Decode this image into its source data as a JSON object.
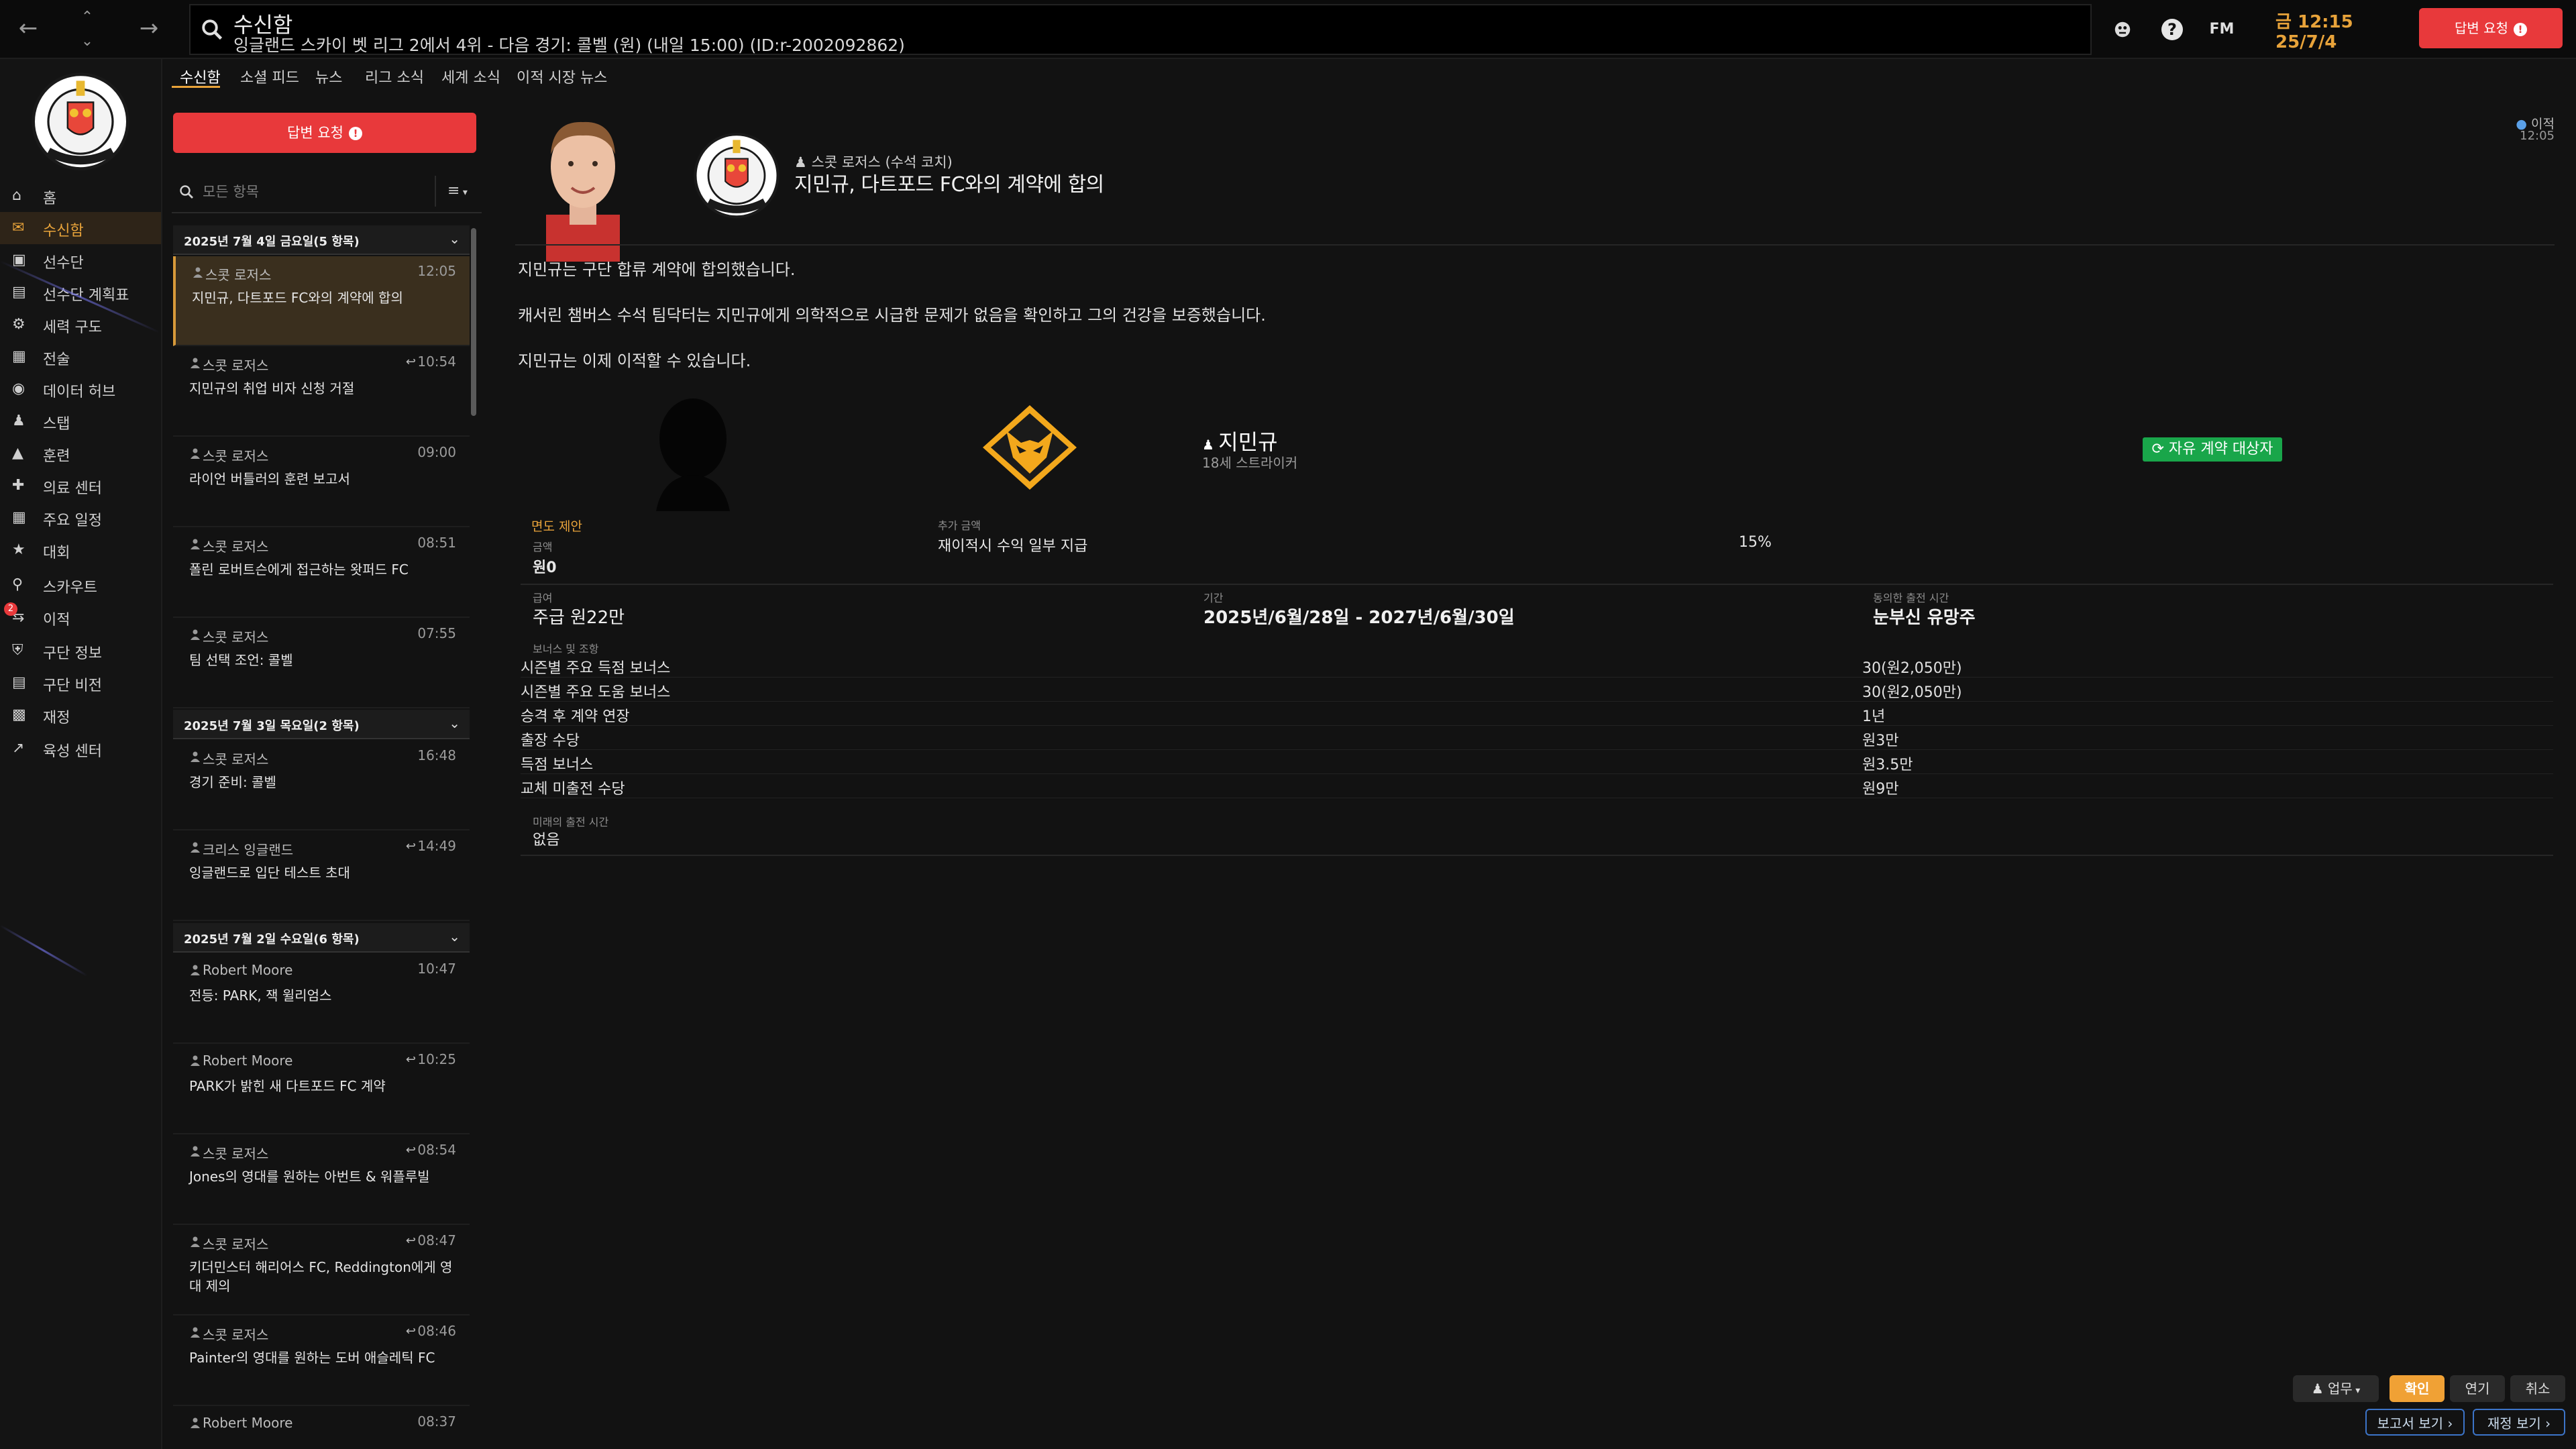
{
  "app": {
    "title": "수신함",
    "subtitle": "잉글랜드 스카이 벳 리그 2에서 4위 - 다음 경기: 콜벨 (원) (내일 15:00) (ID:r-2002092862)",
    "clock_time": "금 12:15",
    "clock_date": "25/7/4",
    "reply_label": "답변 요청",
    "top_icons": [
      "bug-icon",
      "help-icon",
      "fm-icon"
    ],
    "fm_label": "FM",
    "help_label": "?"
  },
  "colors": {
    "accent": "#e8a33a",
    "danger": "#e8393b",
    "success": "#19a64a",
    "link": "#3c74c8"
  },
  "sidebar": {
    "items": [
      {
        "label": "홈",
        "icon": "home-icon"
      },
      {
        "label": "수신함",
        "icon": "inbox-icon",
        "active": true
      },
      {
        "label": "선수단",
        "icon": "shirt-icon"
      },
      {
        "label": "선수단 계획표",
        "icon": "clipboard-icon"
      },
      {
        "label": "세력 구도",
        "icon": "hierarchy-icon"
      },
      {
        "label": "전술",
        "icon": "tactics-icon"
      },
      {
        "label": "데이터 허브",
        "icon": "data-hub-icon"
      },
      {
        "label": "스탭",
        "icon": "staff-icon"
      },
      {
        "label": "훈련",
        "icon": "training-icon"
      },
      {
        "label": "의료 센터",
        "icon": "medical-icon"
      },
      {
        "label": "주요 일정",
        "icon": "calendar-icon"
      },
      {
        "label": "대회",
        "icon": "trophy-icon"
      },
      {
        "label": "스카우트",
        "icon": "scout-icon"
      },
      {
        "label": "이적",
        "icon": "transfer-icon",
        "badge": "2"
      },
      {
        "label": "구단 정보",
        "icon": "club-info-icon"
      },
      {
        "label": "구단 비전",
        "icon": "club-vision-icon"
      },
      {
        "label": "재정",
        "icon": "finance-icon"
      },
      {
        "label": "육성 센터",
        "icon": "development-icon"
      }
    ]
  },
  "tabs": [
    "수신함",
    "소셜 피드",
    "뉴스",
    "리그 소식",
    "세계 소식",
    "이적 시장 뉴스"
  ],
  "list": {
    "search_placeholder": "모든 항목",
    "filter_label": "≡",
    "groups": [
      {
        "title": "2025년 7월 4일 금요일(5 항목)",
        "messages": [
          {
            "sender": "스콧 로저스",
            "time": "12:05",
            "subject": "지민규, 다트포드 FC와의 계약에 합의",
            "selected": true
          },
          {
            "sender": "스콧 로저스",
            "time": "10:54",
            "subject": "지민규의 취업 비자 신청 거절",
            "reply": true
          },
          {
            "sender": "스콧 로저스",
            "time": "09:00",
            "subject": "라이언 버틀러의 훈련 보고서"
          },
          {
            "sender": "스콧 로저스",
            "time": "08:51",
            "subject": "폴린 로버트슨에게 접근하는 왓퍼드 FC"
          },
          {
            "sender": "스콧 로저스",
            "time": "07:55",
            "subject": "팀 선택 조언: 콜벨"
          }
        ]
      },
      {
        "title": "2025년 7월 3일 목요일(2 항목)",
        "messages": [
          {
            "sender": "스콧 로저스",
            "time": "16:48",
            "subject": "경기 준비: 콜벨"
          },
          {
            "sender": "크리스 잉글랜드",
            "time": "14:49",
            "subject": "잉글랜드로 입단 테스트 초대",
            "reply": true
          }
        ]
      },
      {
        "title": "2025년 7월 2일 수요일(6 항목)",
        "messages": [
          {
            "sender": "Robert Moore",
            "time": "10:47",
            "subject": "전등: PARK, 잭 윌리엄스"
          },
          {
            "sender": "Robert Moore",
            "time": "10:25",
            "subject": "PARK가 밝힌 새 다트포드 FC 계약",
            "reply": true
          },
          {
            "sender": "스콧 로저스",
            "time": "08:54",
            "subject": "Jones의 영대를 원하는 아번트 & 워플루빌",
            "reply": true
          },
          {
            "sender": "스콧 로저스",
            "time": "08:47",
            "subject": "키더민스터 해리어스 FC, Reddington에게 영대 제의",
            "reply": true
          },
          {
            "sender": "스콧 로저스",
            "time": "08:46",
            "subject": "Painter의 영대를 원하는 도버 애슬레틱 FC",
            "reply": true
          },
          {
            "sender": "Robert Moore",
            "time": "08:37",
            "subject": ""
          }
        ]
      }
    ]
  },
  "message": {
    "from": "스콧 로저스 (수석 코치)",
    "headline": "지민규, 다트포드 FC와의 계약에 합의",
    "tag": "이적",
    "time": "12:05",
    "paragraphs": [
      "지민규는 구단 합류 계약에 합의했습니다.",
      "캐서린 챔버스 수석 팀닥터는 지민규에게 의학적으로 시급한 문제가 없음을 확인하고 그의 건강을 보증했습니다.",
      "지민규는 이제 이적할 수 있습니다."
    ],
    "player": {
      "name": "지민규",
      "meta": "18세 스트라이커",
      "status": "자유 계약 대상자"
    },
    "offer": {
      "section_label": "면도 제안",
      "amount_label": "금액",
      "amount": "원0",
      "extra_label": "추가 금액",
      "extra": "재이적시 수익 일부 지급",
      "extra_pct": "15%",
      "wage_label": "급여",
      "wage": "주급 원22만",
      "period_label": "기간",
      "period": "2025년/6월/28일 - 2027년/6월/30일",
      "playing_time_label": "동의한 출전 시간",
      "playing_time": "눈부신 유망주",
      "bonus_label": "보너스 및 조항",
      "bonuses": [
        {
          "label": "시즌별 주요 득점 보너스",
          "value": "30(원2,050만)"
        },
        {
          "label": "시즌별 주요 도움 보너스",
          "value": "30(원2,050만)"
        },
        {
          "label": "승격 후 계약 연장",
          "value": "1년"
        },
        {
          "label": "출장 수당",
          "value": "원3만"
        },
        {
          "label": "득점 보너스",
          "value": "원3.5만"
        },
        {
          "label": "교체 미출전 수당",
          "value": "원9만"
        }
      ],
      "future_label": "미래의 출전 시간",
      "future": "없음"
    }
  },
  "bottom": {
    "work": "업무",
    "ok": "확인",
    "delay": "연기",
    "cancel": "취소",
    "report": "보고서 보기",
    "finance": "재정 보기"
  }
}
